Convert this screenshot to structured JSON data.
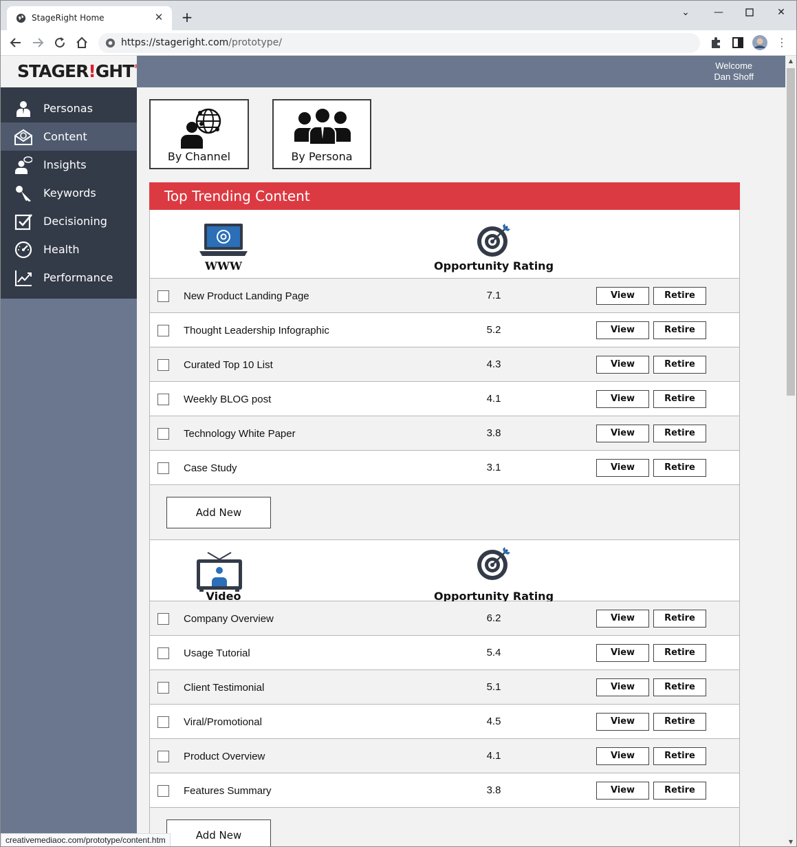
{
  "browser": {
    "tab_title": "StageRight Home",
    "url_scheme_host": "https://stageright.com",
    "url_path": "/prototype/",
    "status_url": "creativemediaoc.com/prototype/content.htm"
  },
  "app": {
    "logo_text_a": "STAGER",
    "logo_text_b": "!",
    "logo_text_c": "GHT",
    "logo_mark": "®",
    "welcome_line1": "Welcome",
    "welcome_line2": "Dan Shoff"
  },
  "sidebar": {
    "items": [
      {
        "label": "Personas",
        "icon": "person-icon"
      },
      {
        "label": "Content",
        "icon": "envelope-at-icon",
        "active": true
      },
      {
        "label": "Insights",
        "icon": "person-speech-icon"
      },
      {
        "label": "Keywords",
        "icon": "key-icon"
      },
      {
        "label": "Decisioning",
        "icon": "checkbox-icon"
      },
      {
        "label": "Health",
        "icon": "gauge-icon"
      },
      {
        "label": "Performance",
        "icon": "chart-line-icon"
      }
    ]
  },
  "filters": {
    "by_channel": "By Channel",
    "by_persona": "By Persona"
  },
  "panel": {
    "title": "Top Trending Content",
    "sections": [
      {
        "channel": "WWW",
        "rating_header": "Opportunity Rating",
        "add_label": "Add New",
        "rows": [
          {
            "name": "New Product Landing Page",
            "score": "7.1"
          },
          {
            "name": "Thought Leadership Infographic",
            "score": "5.2"
          },
          {
            "name": "Curated Top 10 List",
            "score": "4.3"
          },
          {
            "name": "Weekly BLOG post",
            "score": "4.1"
          },
          {
            "name": "Technology White Paper",
            "score": "3.8"
          },
          {
            "name": "Case Study",
            "score": "3.1"
          }
        ]
      },
      {
        "channel": "Video",
        "rating_header": "Opportunity Rating",
        "add_label": "Add New",
        "rows": [
          {
            "name": "Company Overview",
            "score": "6.2"
          },
          {
            "name": "Usage Tutorial",
            "score": "5.4"
          },
          {
            "name": "Client Testimonial",
            "score": "5.1"
          },
          {
            "name": "Viral/Promotional",
            "score": "4.5"
          },
          {
            "name": "Product Overview",
            "score": "4.1"
          },
          {
            "name": "Features Summary",
            "score": "3.8"
          }
        ]
      }
    ],
    "view_label": "View",
    "retire_label": "Retire"
  },
  "colors": {
    "accent_red": "#dc3a42",
    "sidebar_dark": "#333a48",
    "sidebar_slate": "#6b778e"
  }
}
